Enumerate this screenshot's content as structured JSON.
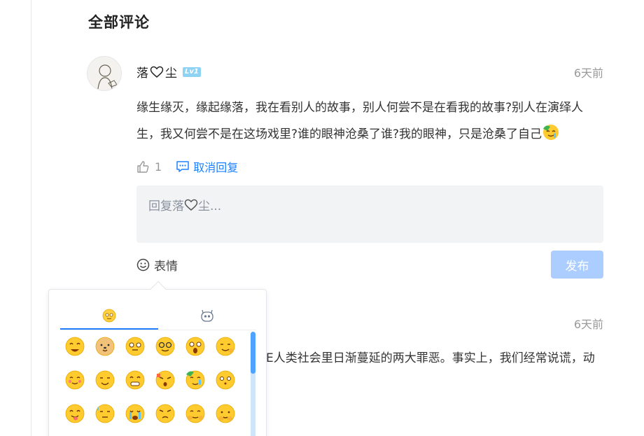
{
  "section": {
    "title": "全部评论"
  },
  "comment1": {
    "username_part1": "落",
    "username_part2": "尘",
    "level": "Lv1",
    "time": "6天前",
    "content": "缘生缘灭，缘起缘落，我在看别人的故事，别人何尝不是在看我的故事?别人在演绎人生，我又何尝不是在这场戏里?谁的眼神沧桑了谁?我的眼神，只是沧桑了自己",
    "likes": "1",
    "cancel_reply_label": "取消回复"
  },
  "reply": {
    "placeholder_prefix": "回复落",
    "placeholder_suffix": "尘...",
    "emoji_label": "表情",
    "publish_label": "发布"
  },
  "emoji_panel": {
    "tabs": [
      "smile-face-tab",
      "robot-face-tab"
    ],
    "emojis": [
      "grin",
      "dog",
      "flushed",
      "nerd",
      "scared",
      "clap",
      "cute",
      "smug",
      "grin-teeth",
      "shocked",
      "cry-money",
      "innocent",
      "tongue",
      "sweat",
      "sob",
      "angry",
      "sheepish",
      "shy"
    ]
  },
  "comment2": {
    "time": "6天前",
    "content_partial": "E人类社会里日渐蔓延的两大罪恶。事实上，我们经常说谎，动"
  },
  "colors": {
    "accent": "#1e80ff",
    "button_disabled": "#abcdff",
    "badge": "#8fd3f4"
  }
}
